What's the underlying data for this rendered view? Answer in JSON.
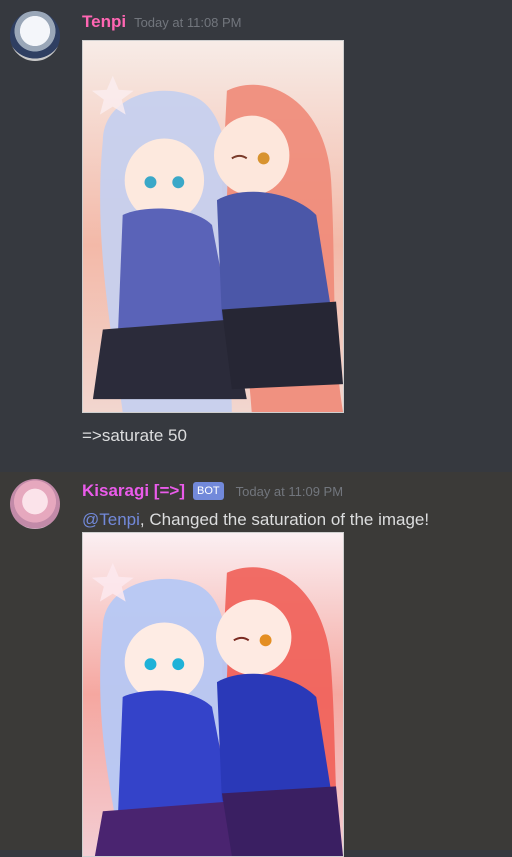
{
  "messages": [
    {
      "username": "Tenpi",
      "timestamp": "Today at 11:08 PM",
      "text": "=>saturate 50",
      "avatar_icon": "avatar-tenpi"
    },
    {
      "username": "Kisaragi [=>]",
      "bot_tag": "BOT",
      "timestamp": "Today at 11:09 PM",
      "mention": "@Tenpi",
      "text": ", Changed the saturation of the image!",
      "avatar_icon": "avatar-kisaragi"
    }
  ],
  "colors": {
    "background": "#36393f",
    "username_tenpi": "#ff66b3",
    "username_kisaragi": "#ea5bea",
    "bot_tag": "#7289da",
    "mention": "#7289da"
  }
}
